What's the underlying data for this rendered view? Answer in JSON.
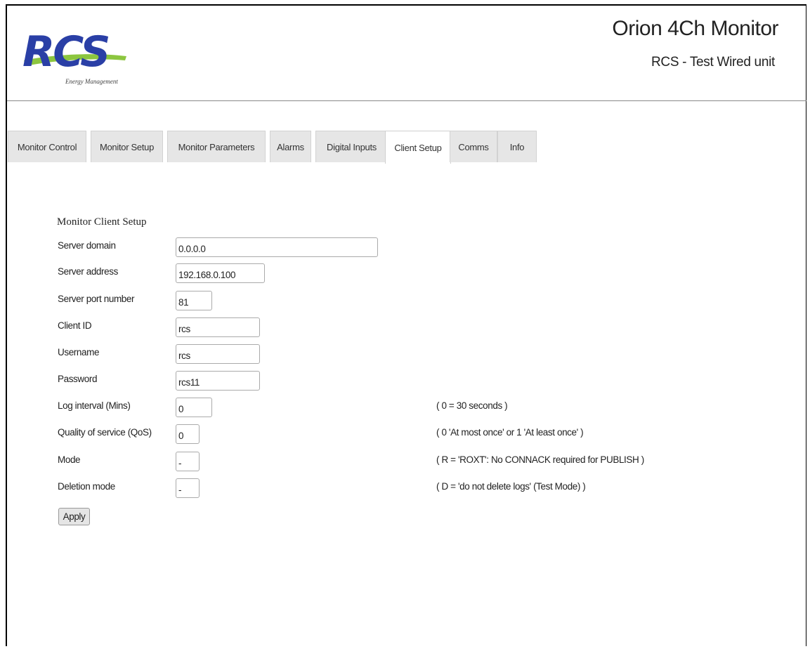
{
  "header": {
    "logo_text": "RCS",
    "logo_subtext": "Energy Management",
    "title": "Orion 4Ch Monitor",
    "subtitle": "RCS - Test Wired unit"
  },
  "tabs": [
    {
      "label": "Monitor Control",
      "active": false
    },
    {
      "label": "Monitor Setup",
      "active": false
    },
    {
      "label": "Monitor Parameters",
      "active": false
    },
    {
      "label": "Alarms",
      "active": false
    },
    {
      "label": "Digital Inputs",
      "active": false
    },
    {
      "label": "Client Setup",
      "active": true
    },
    {
      "label": "Comms",
      "active": false
    },
    {
      "label": "Info",
      "active": false
    }
  ],
  "form": {
    "title": "Monitor Client Setup",
    "fields": [
      {
        "label": "Server domain",
        "value": "0.0.0.0",
        "hint": ""
      },
      {
        "label": "Server address",
        "value": "192.168.0.100",
        "hint": ""
      },
      {
        "label": "Server port number",
        "value": "81",
        "hint": ""
      },
      {
        "label": "Client ID",
        "value": "rcs",
        "hint": ""
      },
      {
        "label": "Username",
        "value": "rcs",
        "hint": ""
      },
      {
        "label": "Password",
        "value": "rcs11",
        "hint": ""
      },
      {
        "label": "Log interval (Mins)",
        "value": "0",
        "hint": "( 0 = 30 seconds )"
      },
      {
        "label": "Quality of service (QoS)",
        "value": "0",
        "hint": "( 0 'At most once' or 1 'At least once' )"
      },
      {
        "label": "Mode",
        "value": "-",
        "hint": "( R = 'ROXT': No CONNACK required for PUBLISH )"
      },
      {
        "label": "Deletion mode",
        "value": "-",
        "hint": "( D = 'do not delete logs' (Test Mode) )"
      }
    ],
    "apply_label": "Apply"
  },
  "colors": {
    "logo_blue": "#2a3fa6",
    "logo_green": "#8cc63f",
    "tab_background": "#e6e6e6",
    "active_tab_background": "#ffffff"
  }
}
